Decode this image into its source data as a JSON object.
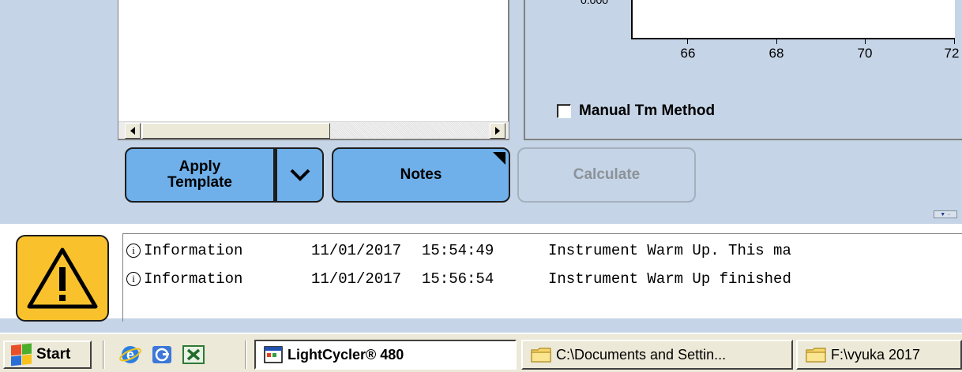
{
  "chart": {
    "y_tick": "0.000",
    "x_ticks": [
      "66",
      "68",
      "70",
      "72"
    ],
    "manual_tm_label": "Manual Tm Method",
    "manual_tm_checked": false
  },
  "buttons": {
    "apply_template_line1": "Apply",
    "apply_template_line2": "Template",
    "notes": "Notes",
    "calculate": "Calculate"
  },
  "log": {
    "entries": [
      {
        "type": "Information",
        "date": "11/01/2017",
        "time": "15:54:49",
        "message": "Instrument Warm Up. This ma"
      },
      {
        "type": "Information",
        "date": "11/01/2017",
        "time": "15:56:54",
        "message": "Instrument Warm Up finished"
      }
    ]
  },
  "taskbar": {
    "start_label": "Start",
    "quick_launch": [
      "internet-explorer-icon",
      "desktop-icon",
      "excel-icon"
    ],
    "tasks": [
      {
        "label": "LightCycler® 480",
        "icon": "app-window-icon",
        "active": true
      },
      {
        "label": "C:\\Documents and Settin...",
        "icon": "folder-icon",
        "active": false
      },
      {
        "label": "F:\\vyuka 2017",
        "icon": "folder-icon",
        "active": false
      }
    ]
  },
  "colors": {
    "background": "#c5d4e6",
    "button_blue": "#6fb0ea",
    "warning_yellow": "#f9c22d",
    "taskbar": "#ece9d8"
  }
}
